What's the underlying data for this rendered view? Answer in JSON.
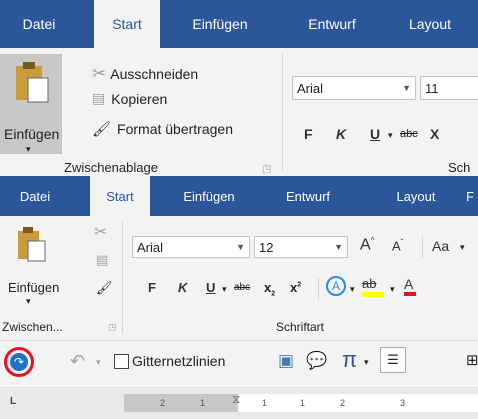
{
  "top_tabs": [
    "Datei",
    "Start",
    "Einfügen",
    "Entwurf",
    "Layout"
  ],
  "top_ribbon": {
    "paste_label": "Einfügen",
    "cut_label": "Ausschneiden",
    "copy_label": "Kopieren",
    "format_painter_label": "Format übertragen",
    "group_label": "Zwischenablage",
    "group_label_right": "Sch",
    "font_name": "Arial",
    "font_size": "11",
    "bold": "F",
    "italic": "K",
    "underline": "U",
    "strike": "abc",
    "subscript": "X",
    "f_cut": "F"
  },
  "bottom_tabs": [
    "Datei",
    "Start",
    "Einfügen",
    "Entwurf",
    "Layout",
    "F"
  ],
  "bottom_ribbon": {
    "paste_label": "Einfügen",
    "group_label": "Zwischen...",
    "font_group_label": "Schriftart",
    "font_name": "Arial",
    "font_size": "12",
    "grow": "A",
    "shrink": "A",
    "case": "Aa",
    "bold": "F",
    "italic": "K",
    "underline": "U",
    "strike": "abc",
    "subscript": "x",
    "superscript": "x",
    "highlight_text": "ab",
    "font_color_text": "A"
  },
  "qat": {
    "gridlines_label": "Gitternetzlinien",
    "pi": "π"
  },
  "ruler": {
    "labels": [
      "2",
      "1",
      "1",
      "1",
      "2",
      "3"
    ],
    "corner": "L"
  },
  "colors": {
    "accent": "#2b579a",
    "highlight_ring": "#e81123",
    "redo_blue": "#1e73c8"
  }
}
